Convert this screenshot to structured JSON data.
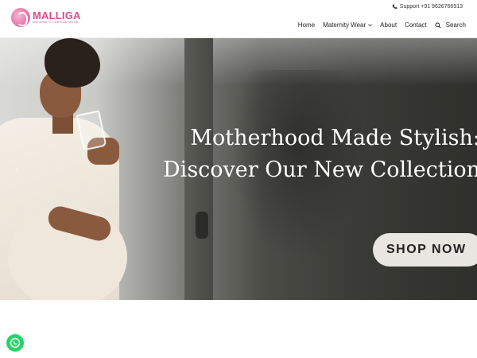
{
  "brand": {
    "name": "MALLIGA",
    "tagline": "MATERNITY FASHION WEAR",
    "accent_color": "#e0488e"
  },
  "support": {
    "text": "Support +91 9626766913",
    "icon": "phone-icon"
  },
  "nav": {
    "items": [
      {
        "label": "Home"
      },
      {
        "label": "Maternity Wear",
        "icon": "chevron-down-icon"
      },
      {
        "label": "About"
      },
      {
        "label": "Contact"
      }
    ],
    "search_label": "Search",
    "search_icon": "search-icon"
  },
  "hero": {
    "title_line1": "Motherhood Made Stylish:",
    "title_line2": "Discover Our New Collection",
    "cta_label": "SHOP NOW",
    "prev_icon": "chevron-left-icon"
  },
  "floating": {
    "whatsapp_icon": "whatsapp-icon",
    "whatsapp_color": "#25d366"
  }
}
